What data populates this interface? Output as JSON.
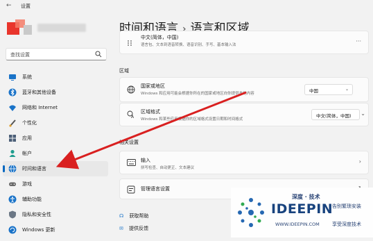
{
  "app": {
    "title": "设置"
  },
  "search": {
    "placeholder": "查找设置"
  },
  "sidebar": {
    "items": [
      {
        "label": "系统",
        "icon": "monitor-icon",
        "color": "#1a73c8"
      },
      {
        "label": "蓝牙和其他设备",
        "icon": "bluetooth-icon",
        "color": "#1a73c8"
      },
      {
        "label": "网络和 Internet",
        "icon": "wifi-icon",
        "color": "#1a73c8"
      },
      {
        "label": "个性化",
        "icon": "brush-icon",
        "color": "#555555"
      },
      {
        "label": "应用",
        "icon": "apps-icon",
        "color": "#4b5e77"
      },
      {
        "label": "帐户",
        "icon": "person-icon",
        "color": "#1f9d8f"
      },
      {
        "label": "时间和语言",
        "icon": "globe-clock-icon",
        "color": "#1a73c8"
      },
      {
        "label": "游戏",
        "icon": "gamepad-icon",
        "color": "#666666"
      },
      {
        "label": "辅助功能",
        "icon": "accessibility-icon",
        "color": "#1a73c8"
      },
      {
        "label": "隐私和安全性",
        "icon": "shield-icon",
        "color": "#6b7785"
      },
      {
        "label": "Windows 更新",
        "icon": "update-icon",
        "color": "#1a73c8"
      }
    ],
    "active_index": 6
  },
  "header": {
    "crumb": "时间和语言",
    "separator": "›",
    "title": "语言和区域"
  },
  "language_card": {
    "title": "中文(简体，中国)",
    "subtitle": "语言包、文本到语音转换、语音识别、手写、基本输入法"
  },
  "region": {
    "section_label": "区域",
    "country": {
      "title": "国家或地区",
      "subtitle": "Windows 和应用可能会根据你所在的国家或地区向你提供本地内容",
      "value": "中国"
    },
    "format": {
      "title": "区域格式",
      "subtitle": "Windows 和某些应用根据你的区域格式设置日期和时间格式",
      "value": "中文(简体，中国)"
    }
  },
  "related": {
    "section_label": "相关设置",
    "input": {
      "title": "输入",
      "subtitle": "拼写检查、自动更正、文本建议"
    },
    "admin": {
      "title": "管理语言设置"
    }
  },
  "links": {
    "help": "获取帮助",
    "feedback": "提供反馈"
  },
  "watermark": {
    "tag": "深度 · 技术",
    "brand": "IDEEPIN",
    "url": "WWW.IDEEPIN.COM",
    "slogan1": "告别繁琐安装",
    "slogan2": "享受深度技术"
  },
  "colors": {
    "accent": "#0067c0",
    "arrow": "#d92020"
  }
}
